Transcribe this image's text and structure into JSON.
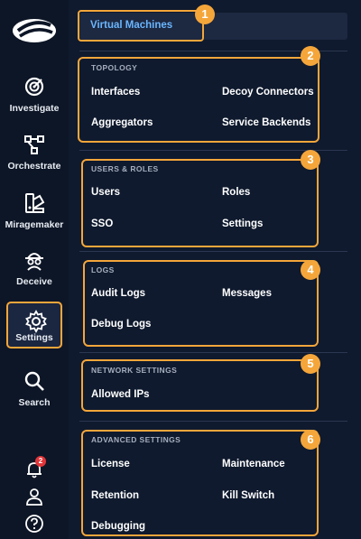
{
  "sidebar": {
    "items": [
      {
        "label": "Investigate",
        "icon": "investigate-icon"
      },
      {
        "label": "Orchestrate",
        "icon": "orchestrate-icon"
      },
      {
        "label": "Miragemaker",
        "icon": "miragemaker-icon"
      },
      {
        "label": "Deceive",
        "icon": "deceive-icon"
      },
      {
        "label": "Settings",
        "icon": "gear-icon",
        "active": true
      },
      {
        "label": "Search",
        "icon": "search-icon"
      }
    ],
    "notifications_count": "2",
    "bottom_icons": [
      "bell-icon",
      "user-icon",
      "help-icon"
    ]
  },
  "menu": {
    "virtual_machines": "Virtual Machines",
    "topology": {
      "title": "TOPOLOGY",
      "items": [
        "Interfaces",
        "Decoy Connectors",
        "Aggregators",
        "Service Backends"
      ]
    },
    "users_roles": {
      "title": "USERS & ROLES",
      "items": [
        "Users",
        "Roles",
        "SSO",
        "Settings"
      ]
    },
    "logs": {
      "title": "LOGS",
      "items": [
        "Audit Logs",
        "Messages",
        "Debug Logs"
      ]
    },
    "network": {
      "title": "NETWORK SETTINGS",
      "items": [
        "Allowed IPs"
      ]
    },
    "advanced": {
      "title": "ADVANCED SETTINGS",
      "items": [
        "License",
        "Maintenance",
        "Retention",
        "Kill Switch",
        "Debugging"
      ]
    }
  },
  "callouts": [
    "1",
    "2",
    "3",
    "4",
    "5",
    "6"
  ],
  "colors": {
    "accent": "#f5a63a",
    "link": "#6ab6ff",
    "background": "#0f1a2e",
    "sidebar": "#0d1626"
  }
}
